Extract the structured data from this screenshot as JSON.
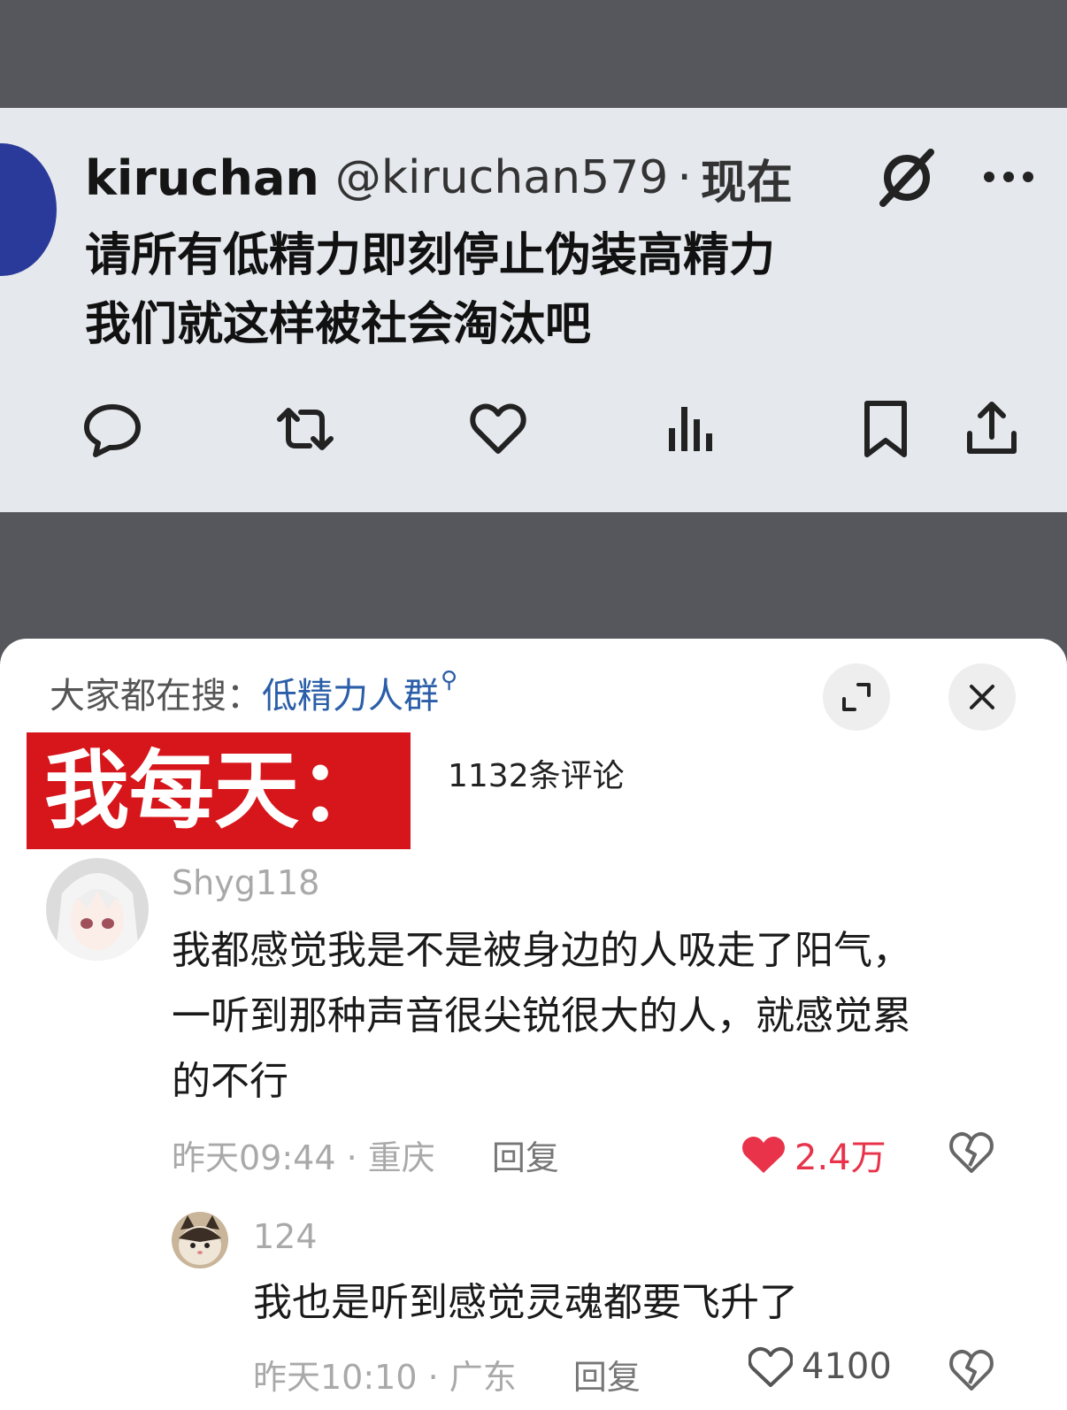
{
  "tweet": {
    "name": "kiruchan",
    "handle": "@kiruchan579",
    "separator": "·",
    "time": "现在",
    "lines": [
      "请所有低精力即刻停止伪装高精力",
      "我们就这样被社会淘汰吧"
    ]
  },
  "sheet": {
    "search_prefix": "大家都在搜：",
    "search_keyword": "低精力人群",
    "banner_text": "我每天：",
    "comment_count": "1132条评论"
  },
  "comments": [
    {
      "user": "Shyg118",
      "text_lines": [
        "我都感觉我是不是被身边的人吸走了阳气，",
        "一听到那种声音很尖锐很大的人，就感觉累",
        "的不行"
      ],
      "time": "昨天09:44",
      "sep": "·",
      "location": "重庆",
      "reply_label": "回复",
      "likes": "2.4万"
    },
    {
      "user": "124",
      "text_lines": [
        "我也是听到感觉灵魂都要飞升了"
      ],
      "time": "昨天10:10",
      "sep": "·",
      "location": "广东",
      "reply_label": "回复",
      "likes": "4100"
    }
  ],
  "colors": {
    "banner_red": "#d6161b",
    "like_red": "#e8334a",
    "keyword_blue": "#2b5ea8"
  }
}
